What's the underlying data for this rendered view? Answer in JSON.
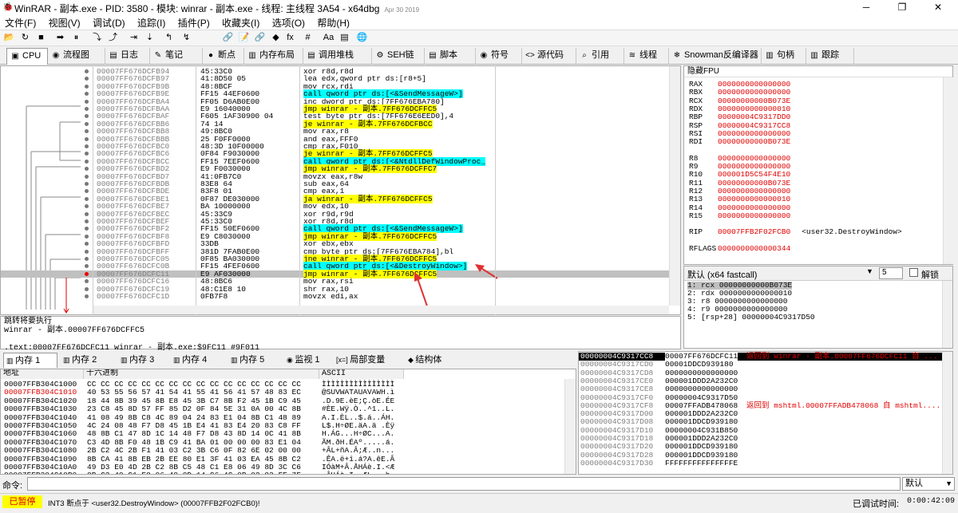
{
  "window": {
    "title": "WinRAR - 副本.exe - PID: 3580 - 模块: winrar - 副本.exe - 线程: 主线程 3A54 - x64dbg",
    "date": "Apr 30 2019",
    "controls": [
      "─",
      "❐",
      "✕"
    ]
  },
  "menu": [
    "文件(F)",
    "视图(V)",
    "调试(D)",
    "追踪(I)",
    "插件(P)",
    "收藏夹(I)",
    "选项(O)",
    "帮助(H)"
  ],
  "toolbar_icons": [
    "📂",
    "↻",
    "■",
    "➡",
    "⏸",
    "⤵",
    "⤴",
    "⇥",
    "⇣",
    "↰",
    "↯",
    "🔗",
    "📝",
    "🔗",
    "◆",
    "fx",
    "#",
    "Aa",
    "▤",
    "🌐"
  ],
  "tabs": [
    {
      "icon": "▣",
      "label": "CPU"
    },
    {
      "icon": "◉",
      "label": "流程图"
    },
    {
      "icon": "▤",
      "label": "日志"
    },
    {
      "icon": "✎",
      "label": "笔记"
    },
    {
      "icon": "●",
      "label": "断点"
    },
    {
      "icon": "▥",
      "label": "内存布局"
    },
    {
      "icon": "▤",
      "label": "调用堆栈"
    },
    {
      "icon": "⚙",
      "label": "SEH链"
    },
    {
      "icon": "▤",
      "label": "脚本"
    },
    {
      "icon": "◉",
      "label": "符号"
    },
    {
      "icon": "<>",
      "label": "源代码"
    },
    {
      "icon": "⌕",
      "label": "引用"
    },
    {
      "icon": "≋",
      "label": "线程"
    },
    {
      "icon": "❄",
      "label": "Snowman反编译器"
    },
    {
      "icon": "▥",
      "label": "句柄"
    },
    {
      "icon": "▥",
      "label": "跟踪"
    }
  ],
  "disasm": [
    {
      "a": "00007FF676DCFB94",
      "h": "45:33C0",
      "d": "xor r8d,r8d"
    },
    {
      "a": "00007FF676DCFB97",
      "h": "41:8D50 05",
      "d": "lea edx,qword ptr ds:[r8+5]"
    },
    {
      "a": "00007FF676DCFB9B",
      "h": "48:8BCF",
      "d": "mov rcx,rdi"
    },
    {
      "a": "00007FF676DCFB9E",
      "h": "FF15 44EF0600",
      "d": "call qword ptr ds:[<&SendMessageW>]",
      "hl": "call"
    },
    {
      "a": "00007FF676DCFBA4",
      "h": "FF05 D6AB0E00",
      "d": "inc dword ptr ds:[7FF676EBA780]"
    },
    {
      "a": "00007FF676DCFBAA",
      "h": "E9 16040000",
      "d": "jmp winrar - 副本.7FF676DCFFC5",
      "hl": "jmp"
    },
    {
      "a": "00007FF676DCFBAF",
      "h": "F605 1AF30900 04",
      "d": "test byte ptr ds:[7FF676E6EED0],4"
    },
    {
      "a": "00007FF676DCFBB6",
      "h": "74 14",
      "d": "je winrar - 副本.7FF676DCFBCC",
      "hl": "jmp"
    },
    {
      "a": "00007FF676DCFBB8",
      "h": "49:8BC0",
      "d": "mov rax,r8"
    },
    {
      "a": "00007FF676DCFBBB",
      "h": "25 F0FF0000",
      "d": "and eax,FFF0"
    },
    {
      "a": "00007FF676DCFBC0",
      "h": "48:3D 10F00000",
      "d": "cmp rax,F010"
    },
    {
      "a": "00007FF676DCFBC6",
      "h": "0F84 F9030000",
      "d": "je winrar - 副本.7FF676DCFFC5",
      "hl": "jmp"
    },
    {
      "a": "00007FF676DCFBCC",
      "h": "FF15 7EEF0600",
      "d": "call qword ptr ds:[<&NtdllDefWindowProc_",
      "hl": "call"
    },
    {
      "a": "00007FF676DCFBD2",
      "h": "E9 F0030000",
      "d": "jmp winrar - 副本.7FF676DCFFC7",
      "hl": "jmp"
    },
    {
      "a": "00007FF676DCFBD7",
      "h": "41:0FB7C0",
      "d": "movzx eax,r8w"
    },
    {
      "a": "00007FF676DCFBDB",
      "h": "83E8 64",
      "d": "sub eax,64"
    },
    {
      "a": "00007FF676DCFBDE",
      "h": "83F8 01",
      "d": "cmp eax,1"
    },
    {
      "a": "00007FF676DCFBE1",
      "h": "0F87 DE030000",
      "d": "ja winrar - 副本.7FF676DCFFC5",
      "hl": "jmp"
    },
    {
      "a": "00007FF676DCFBE7",
      "h": "BA 10000000",
      "d": "mov edx,10"
    },
    {
      "a": "00007FF676DCFBEC",
      "h": "45:33C9",
      "d": "xor r9d,r9d"
    },
    {
      "a": "00007FF676DCFBEF",
      "h": "45:33C0",
      "d": "xor r8d,r8d"
    },
    {
      "a": "00007FF676DCFBF2",
      "h": "FF15 50EF0600",
      "d": "call qword ptr ds:[<&SendMessageW>]",
      "hl": "call"
    },
    {
      "a": "00007FF676DCFBF8",
      "h": "E9 C8030000",
      "d": "jmp winrar - 副本.7FF676DCFFC5",
      "hl": "jmp"
    },
    {
      "a": "00007FF676DCFBFD",
      "h": "33DB",
      "d": "xor ebx,ebx"
    },
    {
      "a": "00007FF676DCFBFF",
      "h": "381D 7FAB0E00",
      "d": "cmp byte ptr ds:[7FF676EBA784],bl"
    },
    {
      "a": "00007FF676DCFC05",
      "h": "0F85 BA030000",
      "d": "jne winrar - 副本.7FF676DCFFC5",
      "hl": "jmp"
    },
    {
      "a": "00007FF676DCFC0B",
      "h": "FF15 4FEF0600",
      "d": "call qword ptr ds:[<&DestroyWindow>]",
      "hl": "call"
    },
    {
      "a": "00007FF676DCFC11",
      "h": "E9 AF030000",
      "d": "jmp winrar - 副本.7FF676DCFFC5",
      "hl": "jmp",
      "sel": true
    },
    {
      "a": "00007FF676DCFC16",
      "h": "48:8BC6",
      "d": "mov rax,rsi"
    },
    {
      "a": "00007FF676DCFC19",
      "h": "48:C1E8 10",
      "d": "shr rax,10"
    },
    {
      "a": "00007FF676DCFC1D",
      "h": "0FB7F8",
      "d": "movzx edi,ax"
    }
  ],
  "info": [
    "跳转将要执行",
    "winrar - 副本.00007FF676DCFFC5",
    "",
    ".text:00007FF676DCFC11 winrar - 副本.exe:$9FC11 #9F011"
  ],
  "regs_header": "隐藏FPU",
  "regs": [
    {
      "n": "RAX",
      "v": "0000000000000000"
    },
    {
      "n": "RBX",
      "v": "0000000000000000"
    },
    {
      "n": "RCX",
      "v": "00000000000B073E"
    },
    {
      "n": "RDX",
      "v": "0000000000000010"
    },
    {
      "n": "RBP",
      "v": "00000004C9317DD0"
    },
    {
      "n": "RSP",
      "v": "00000004C9317CC8"
    },
    {
      "n": "RSI",
      "v": "0000000000000000"
    },
    {
      "n": "RDI",
      "v": "00000000000B073E"
    },
    {
      "n": "",
      "v": ""
    },
    {
      "n": "R8",
      "v": "0000000000000000"
    },
    {
      "n": "R9",
      "v": "0000000000000000"
    },
    {
      "n": "R10",
      "v": "000001D5C54F4E10"
    },
    {
      "n": "R11",
      "v": "00000000000B073E"
    },
    {
      "n": "R12",
      "v": "0000000000000000"
    },
    {
      "n": "R13",
      "v": "0000000000000010"
    },
    {
      "n": "R14",
      "v": "0000000000000000"
    },
    {
      "n": "R15",
      "v": "0000000000000000"
    },
    {
      "n": "",
      "v": ""
    },
    {
      "n": "RIP",
      "v": "00007FFB2F02FCB0",
      "c": "<user32.DestroyWindow>"
    },
    {
      "n": "",
      "v": ""
    },
    {
      "n": "RFLAGS",
      "v": "0000000000000344"
    }
  ],
  "args": {
    "default_label": "默认 (x64 fastcall)",
    "count": "5",
    "unlock": "解锁",
    "rows": [
      "1: rcx 00000000000B073E",
      "2: rdx 0000000000000010",
      "3: r8 0000000000000000",
      "4: r9 0000000000000000",
      "5: [rsp+28] 00000004C9317D50"
    ]
  },
  "dump_tabs": [
    {
      "icon": "▥",
      "label": "内存 1"
    },
    {
      "icon": "▥",
      "label": "内存 2"
    },
    {
      "icon": "▥",
      "label": "内存 3"
    },
    {
      "icon": "▥",
      "label": "内存 4"
    },
    {
      "icon": "▥",
      "label": "内存 5"
    },
    {
      "icon": "◉",
      "label": "监视 1"
    },
    {
      "icon": "[x=]",
      "label": "局部变量"
    },
    {
      "icon": "◆",
      "label": "结构体"
    }
  ],
  "dump_headers": {
    "addr": "地址",
    "hex": "十六进制",
    "ascii": "ASCII"
  },
  "dump": [
    {
      "a": "00007FFB304C1000",
      "x": "CC CC CC CC CC CC CC CC CC CC CC CC CC CC CC CC",
      "s": "ÌÌÌÌÌÌÌÌÌÌÌÌÌÌÌÌ"
    },
    {
      "a": "00007FFB304C1010",
      "x": "40 53 55 56 57 41 54 41 55 41 56 41 57 48 83 EC",
      "s": "@SUVWATAUAVAWH.ì",
      "red": true
    },
    {
      "a": "00007FFB304C1020",
      "x": "18 44 8B 39 45 8B E8 45 3B C7 8B F2 45 1B C9 45",
      "s": ".D.9E.èE;Ç.òE.ÉE"
    },
    {
      "a": "00007FFB304C1030",
      "x": "23 C8 45 8D 57 FF 85 D2 0F 84 5E 31 0A 00 4C 8B",
      "s": "#ÈE.Wÿ.Ò..^1..L."
    },
    {
      "a": "00007FFB304C1040",
      "x": "41 08 49 8B C8 4C 89 04 24 83 E1 04 8B C1 48 89",
      "s": "A.I.ÈL..$.á..ÁH."
    },
    {
      "a": "00007FFB304C1050",
      "x": "4C 24 08 48 F7 D8 45 1B E4 41 83 E4 20 83 C8 FF",
      "s": "L$.H÷ØE.äA.ä .Èÿ"
    },
    {
      "a": "00007FFB304C1060",
      "x": "48 8B C1 47 8D 1C 14 48 F7 D8 43 8D 14 0C 41 8B",
      "s": "H.ÁG...H÷ØC...A."
    },
    {
      "a": "00007FFB304C1070",
      "x": "C3 4D 8B F0 48 1B C9 41 BA 01 00 00 00 83 E1 04",
      "s": "ÃM.ðH.ÉAº.....á."
    },
    {
      "a": "00007FFB304C1080",
      "x": "2B C2 4C 2B F1 41 03 C2 3B C6 0F 82 6E 02 00 00",
      "s": "+ÂL+ñA.Â;Æ..n..."
    },
    {
      "a": "00007FFB304C1090",
      "x": "8B CA 41 8B EB 2B EE 80 E1 3F 41 03 EA 45 8B C2",
      "s": ".ÊA.ë+î.á?A.êE.Â"
    },
    {
      "a": "00007FFB304C10A0",
      "x": "49 D3 E0 4D 2B C2 8B C5 48 C1 E8 06 49 8D 3C C6",
      "s": "IÓàM+Â.ÅHÁè.I.<Æ"
    },
    {
      "a": "00007FFB304C10B0",
      "x": "8B C2 48 C1 E8 06 49 8D 14 C6 4C 0B 02 83 FE 7F",
      "s": ".ÂHÁè.I..ÆL...þ."
    }
  ],
  "stack": [
    {
      "a": "00000004C9317CC8",
      "v": "00007FF676DCFC11",
      "c": "返回到 winrar - 副本.00007FF676DCFC11 自 ...",
      "sel": true
    },
    {
      "a": "00000004C9317CD0",
      "v": "00001DDCD939180",
      "c": ""
    },
    {
      "a": "00000004C9317CD8",
      "v": "0000000000000000",
      "c": ""
    },
    {
      "a": "00000004C9317CE0",
      "v": "000001DDD2A232C0",
      "c": ""
    },
    {
      "a": "00000004C9317CE8",
      "v": "0000000000000000",
      "c": ""
    },
    {
      "a": "00000004C9317CF0",
      "v": "00000004C9317D50",
      "c": ""
    },
    {
      "a": "00000004C9317CF8",
      "v": "00007FFADB478068",
      "c": "返回到 mshtml.00007FFADB478068 自 mshtml...."
    },
    {
      "a": "00000004C9317D00",
      "v": "000001DDD2A232C0",
      "c": ""
    },
    {
      "a": "00000004C9317D08",
      "v": "000001DDCD939180",
      "c": ""
    },
    {
      "a": "00000004C9317D10",
      "v": "00000004C931B850",
      "c": ""
    },
    {
      "a": "00000004C9317D18",
      "v": "000001DDD2A232C0",
      "c": ""
    },
    {
      "a": "00000004C9317D20",
      "v": "000001DDCD939180",
      "c": ""
    },
    {
      "a": "00000004C9317D28",
      "v": "000001DDCD939180",
      "c": ""
    },
    {
      "a": "00000004C9317D30",
      "v": "FFFFFFFFFFFFFFFE",
      "c": ""
    }
  ],
  "command": {
    "label": "命令:",
    "default": "默认"
  },
  "status": {
    "state": "已暂停",
    "message": "INT3 断点于 <user32.DestroyWindow> (00007FFB2F02FCB0)!",
    "time_label": "已调试时间:",
    "time": "0:00:42:09"
  },
  "colors": {
    "red": "#e00000",
    "yellow": "#ffff00",
    "cyan": "#00ffff",
    "arrow": "#e03030"
  }
}
